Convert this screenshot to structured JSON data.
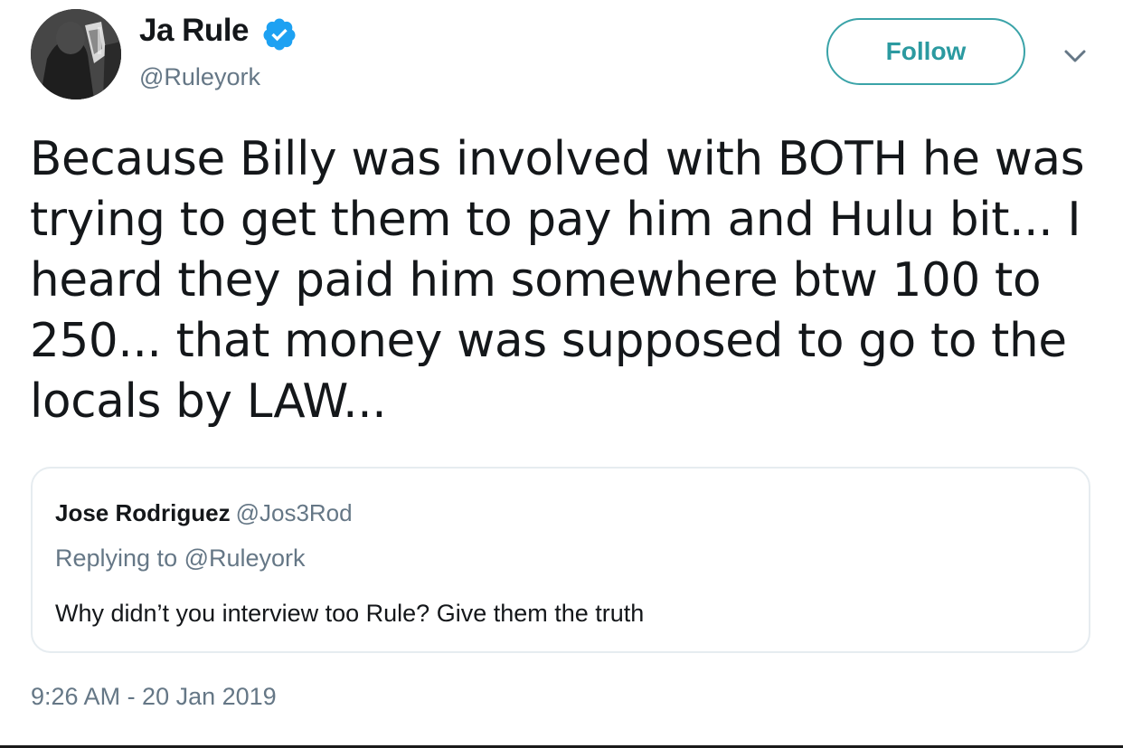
{
  "author": {
    "display_name": "Ja Rule",
    "handle": "@Ruleyork",
    "verified": true,
    "avatar_icon": "profile-photo"
  },
  "actions": {
    "follow_label": "Follow",
    "menu_icon": "chevron-down-icon"
  },
  "tweet": {
    "text": "Because Billy was involved with BOTH he was trying to get them to pay him and Hulu bit... I heard they paid him somewhere btw 100 to 250... that money was supposed to go to the locals by LAW...",
    "timestamp": "9:26 AM - 20 Jan 2019"
  },
  "quoted_tweet": {
    "display_name": "Jose Rodriguez",
    "handle": "@Jos3Rod",
    "replying_to": "Replying to @Ruleyork",
    "text": "Why didn’t you interview too Rule? Give them the truth"
  },
  "colors": {
    "accent": "#1da1f2",
    "follow_border": "#3aa3a8",
    "secondary_text": "#657786",
    "primary_text": "#14171a",
    "card_border": "#e6ecf0"
  }
}
